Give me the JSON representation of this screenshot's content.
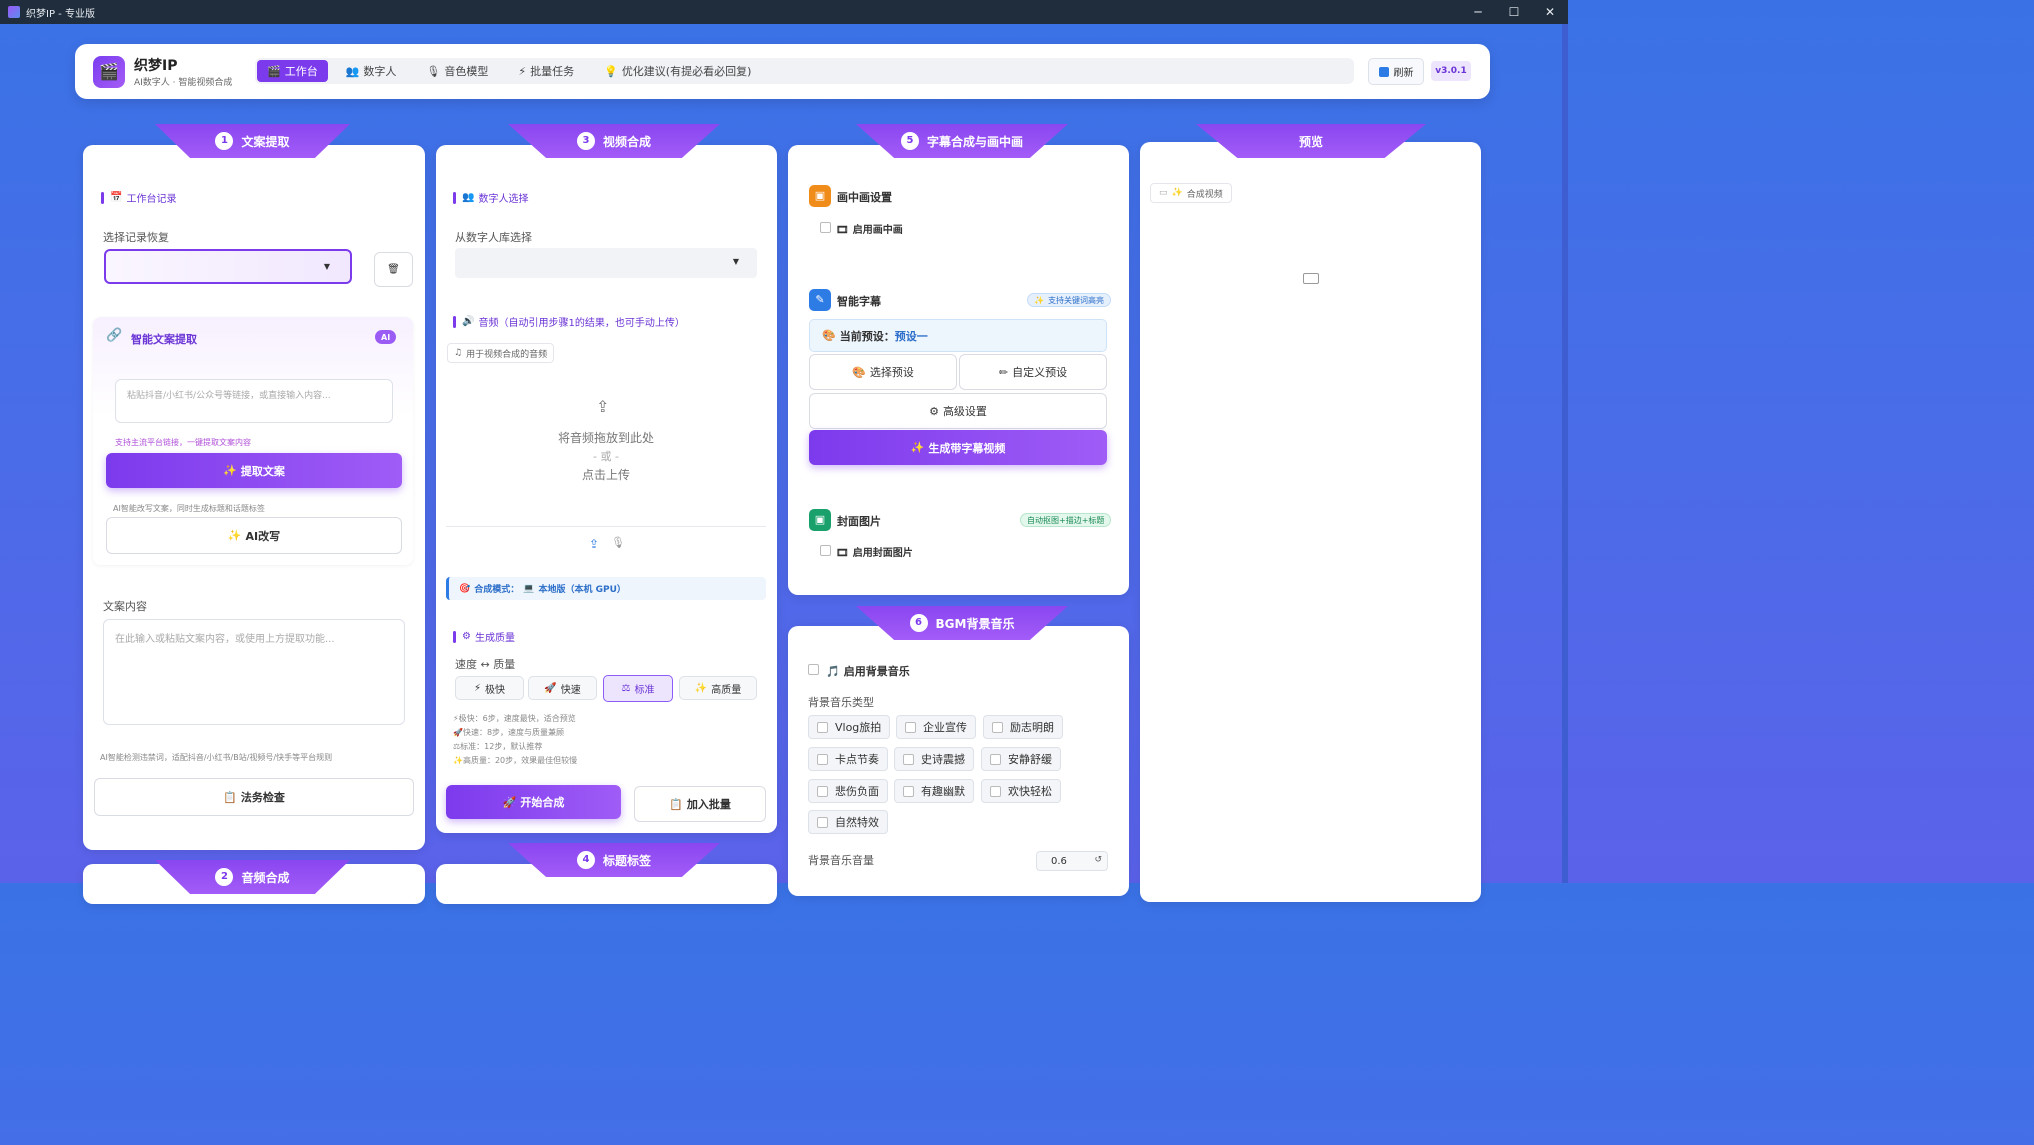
{
  "window": {
    "title": "织梦IP - 专业版",
    "controls": [
      "─",
      "☐",
      "✕"
    ]
  },
  "header": {
    "app_name": "织梦IP",
    "app_subtitle": "AI数字人 · 智能视频合成",
    "tabs": [
      {
        "label": "工作台",
        "icon": "🎬"
      },
      {
        "label": "数字人",
        "icon": "👥"
      },
      {
        "label": "音色模型",
        "icon": "🎙"
      },
      {
        "label": "批量任务",
        "icon": "⚡"
      },
      {
        "label": "优化建议(有提必看必回复)",
        "icon": "💡"
      }
    ],
    "refresh_label": "刷新",
    "version": "v3.0.1"
  },
  "col1": {
    "step_num": "1",
    "step_title": "文案提取",
    "record_section": "工作台记录",
    "record_label": "选择记录恢复",
    "smart_title": "智能文案提取",
    "ai_badge": "AI",
    "link_placeholder": "粘贴抖音/小红书/公众号等链接，或直接输入内容...",
    "link_hint": "支持主流平台链接，一键提取文案内容",
    "extract_btn": "提取文案",
    "rewrite_hint": "AI智能改写文案，同时生成标题和话题标签",
    "rewrite_btn": "AI改写",
    "content_label": "文案内容",
    "content_placeholder": "在此输入或粘贴文案内容，或使用上方提取功能...",
    "law_hint": "AI智能检测违禁词，适配抖音/小红书/B站/视频号/快手等平台规则",
    "law_btn": "法务检查",
    "next_step_num": "2",
    "next_step_title": "音频合成"
  },
  "col2": {
    "step_num": "3",
    "step_title": "视频合成",
    "avatar_section": "数字人选择",
    "avatar_label": "从数字人库选择",
    "audio_section": "音频（自动引用步骤1的结果，也可手动上传）",
    "audio_tag": "用于视频合成的音频",
    "drop_text": "将音频拖放到此处",
    "drop_or": "- 或 -",
    "drop_click": "点击上传",
    "mode_label": "合成模式：",
    "mode_value": "本地版（本机 GPU）",
    "quality_section": "生成质量",
    "quality_label": "速度 ↔ 质量",
    "quality_options": [
      {
        "label": "极快",
        "icon": "⚡"
      },
      {
        "label": "快速",
        "icon": "🚀"
      },
      {
        "label": "标准",
        "icon": "⚖"
      },
      {
        "label": "高质量",
        "icon": "✨"
      }
    ],
    "quality_selected": "标准",
    "quality_notes": [
      "⚡极快：6步，速度最快，适合预览",
      "🚀快速：8步，速度与质量兼顾",
      "⚖标准：12步，默认推荐",
      "✨高质量：20步，效果最佳但较慢"
    ],
    "start_btn": "开始合成",
    "batch_btn": "加入批量",
    "next_step_num": "4",
    "next_step_title": "标题标签"
  },
  "col3": {
    "step_num": "5",
    "step_title": "字幕合成与画中画",
    "pip_title": "画中画设置",
    "pip_enable": "启用画中画",
    "sub_title": "智能字幕",
    "sub_badge": "支持关键词高亮",
    "preset_label": "当前预设：",
    "preset_value": "预设一",
    "select_preset": "选择预设",
    "custom_preset": "自定义预设",
    "advanced": "高级设置",
    "gen_sub_btn": "生成带字幕视频",
    "cover_title": "封面图片",
    "cover_badge": "自动抠图+描边+标题",
    "cover_enable": "启用封面图片"
  },
  "col3b": {
    "step_num": "6",
    "step_title": "BGM背景音乐",
    "enable": "启用背景音乐",
    "type_label": "背景音乐类型",
    "types": [
      "Vlog旅拍",
      "企业宣传",
      "励志明朗",
      "卡点节奏",
      "史诗震撼",
      "安静舒缓",
      "悲伤负面",
      "有趣幽默",
      "欢快轻松",
      "自然特效"
    ],
    "volume_label": "背景音乐音量",
    "volume_value": "0.6"
  },
  "col4": {
    "title": "预览",
    "tab": "合成视频"
  },
  "colors": {
    "accent": "#7c3aed",
    "bg": "#4a6ce8"
  }
}
